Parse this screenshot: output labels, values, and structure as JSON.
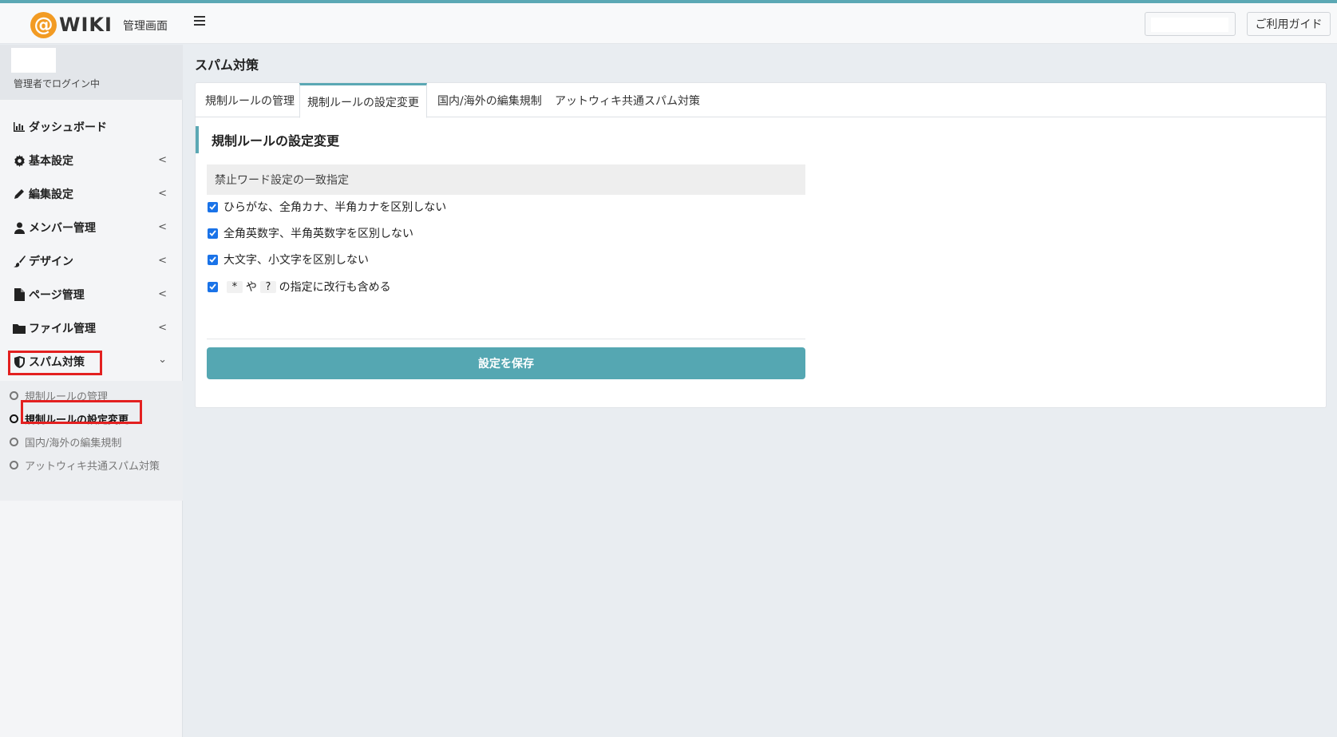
{
  "header": {
    "logo_text": "WIKI",
    "title": "管理画面",
    "guide_label": "ご利用ガイド"
  },
  "user": {
    "status": "管理者でログイン中"
  },
  "sidebar": {
    "items": [
      {
        "label": "ダッシュボード",
        "icon": "bar-chart-icon"
      },
      {
        "label": "基本設定",
        "icon": "gear-icon"
      },
      {
        "label": "編集設定",
        "icon": "pencil-icon"
      },
      {
        "label": "メンバー管理",
        "icon": "user-icon"
      },
      {
        "label": "デザイン",
        "icon": "brush-icon"
      },
      {
        "label": "ページ管理",
        "icon": "file-icon"
      },
      {
        "label": "ファイル管理",
        "icon": "folder-icon"
      },
      {
        "label": "スパム対策",
        "icon": "shield-icon"
      }
    ],
    "submenu": [
      {
        "label": "規制ルールの管理"
      },
      {
        "label": "規制ルールの設定変更"
      },
      {
        "label": "国内/海外の編集規制"
      },
      {
        "label": "アットウィキ共通スパム対策"
      }
    ]
  },
  "main": {
    "page_title": "スパム対策",
    "tabs": [
      {
        "label": "規制ルールの管理"
      },
      {
        "label": "規制ルールの設定変更"
      },
      {
        "label": "国内/海外の編集規制"
      },
      {
        "label": "アットウィキ共通スパム対策"
      }
    ],
    "section_title": "規制ルールの設定変更",
    "subsection_title": "禁止ワード設定の一致指定",
    "options": [
      {
        "label": "ひらがな、全角カナ、半角カナを区別しない",
        "checked": true
      },
      {
        "label": "全角英数字、半角英数字を区別しない",
        "checked": true
      },
      {
        "label": "大文字、小文字を区別しない",
        "checked": true
      }
    ],
    "option4": {
      "chip1": "*",
      "mid": "や",
      "chip2": "?",
      "tail": "の指定に改行も含める",
      "checked": true
    },
    "save_label": "設定を保存"
  },
  "colors": {
    "accent": "#5ba8b4",
    "button": "#55a7b2",
    "highlight": "#e32020",
    "logo": "#f29b23",
    "checkbox": "#1a73e8"
  }
}
